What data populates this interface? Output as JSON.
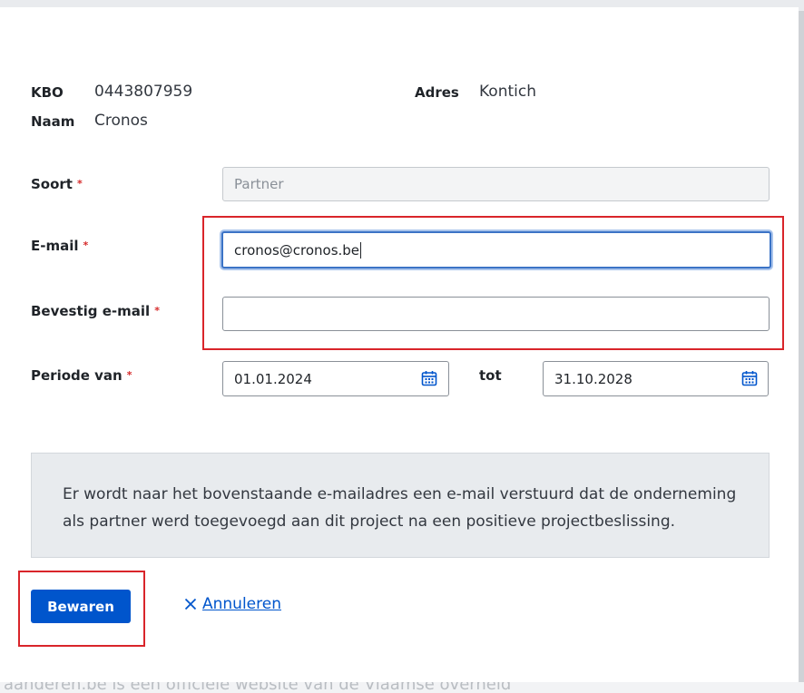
{
  "background": {
    "footer_text": "aanderen.be is een officiële website van de Vlaamse overheid"
  },
  "company": {
    "kbo_label": "KBO",
    "kbo_value": "0443807959",
    "naam_label": "Naam",
    "naam_value": "Cronos",
    "adres_label": "Adres",
    "adres_value": "Kontich"
  },
  "form": {
    "soort_label": "Soort",
    "soort_value": "Partner",
    "email_label": "E-mail",
    "email_value": "cronos@cronos.be",
    "confirm_email_label": "Bevestig e-mail",
    "confirm_email_value": "",
    "periode_label": "Periode van",
    "periode_from": "01.01.2024",
    "tot_label": "tot",
    "periode_to": "31.10.2028",
    "required_marker": "*"
  },
  "info": {
    "line1": "Er wordt naar het bovenstaande e-mailadres een e-mail verstuurd dat de onderneming",
    "line2": "als partner werd toegevoegd aan dit project na een positieve projectbeslissing."
  },
  "actions": {
    "save_label": "Bewaren",
    "cancel_label": "Annuleren"
  },
  "colors": {
    "primary": "#0055cc",
    "required": "#d62a2a",
    "highlight": "#d9252a",
    "info_bg": "#e8ebee"
  }
}
